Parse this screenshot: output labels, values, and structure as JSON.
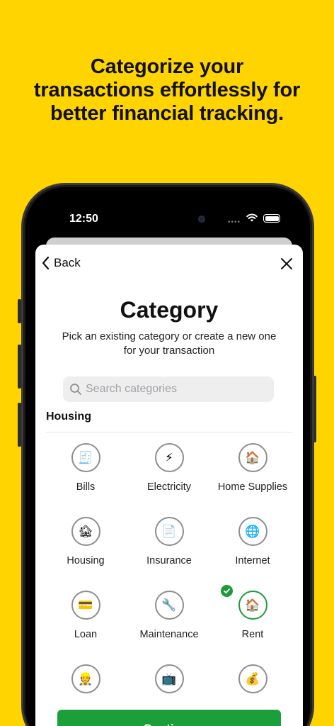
{
  "headline": {
    "line1": "Categorize your",
    "line2": "transactions effortlessly for",
    "line3": "better financial tracking."
  },
  "status_bar": {
    "time": "12:50"
  },
  "nav": {
    "back_label": "Back"
  },
  "page": {
    "title": "Category",
    "subtitle_line1": "Pick an existing category or create a new one",
    "subtitle_line2": "for your transaction"
  },
  "search": {
    "placeholder": "Search categories",
    "value": ""
  },
  "section": {
    "title": "Housing"
  },
  "categories": [
    {
      "label": "Bills",
      "icon": "receipt-icon",
      "glyph": "🧾",
      "selected": false
    },
    {
      "label": "Electricity",
      "icon": "lightning-icon",
      "glyph": "⚡",
      "selected": false
    },
    {
      "label": "Home Supplies",
      "icon": "house-icon",
      "glyph": "🏠",
      "selected": false
    },
    {
      "label": "Housing",
      "icon": "derelict-house-icon",
      "glyph": "🏚",
      "selected": false
    },
    {
      "label": "Insurance",
      "icon": "document-icon",
      "glyph": "📄",
      "selected": false
    },
    {
      "label": "Internet",
      "icon": "globe-icon",
      "glyph": "🌐",
      "selected": false
    },
    {
      "label": "Loan",
      "icon": "credit-card-icon",
      "glyph": "💳",
      "selected": false
    },
    {
      "label": "Maintenance",
      "icon": "wrench-icon",
      "glyph": "🔧",
      "selected": false
    },
    {
      "label": "Rent",
      "icon": "house-icon",
      "glyph": "🏠",
      "selected": true
    },
    {
      "label": "",
      "icon": "person-icon",
      "glyph": "👷",
      "selected": false
    },
    {
      "label": "",
      "icon": "tv-icon",
      "glyph": "📺",
      "selected": false
    },
    {
      "label": "",
      "icon": "money-bag-icon",
      "glyph": "💰",
      "selected": false
    }
  ],
  "continue_label": "Continue",
  "colors": {
    "background": "#FFD400",
    "accent": "#1A9F3A"
  }
}
